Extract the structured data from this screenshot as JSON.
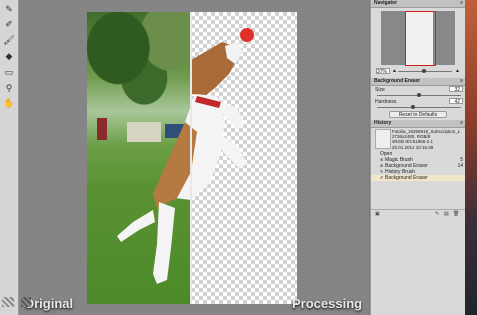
{
  "toolbar": {
    "tools": [
      "magic-brush-icon",
      "background-eraser-icon",
      "brush-icon",
      "bucket-icon",
      "eraser-icon",
      "zoom-icon",
      "hand-icon"
    ]
  },
  "workspace": {
    "left_label": "Original",
    "right_label": "Processing"
  },
  "navigator": {
    "title": "Navigator",
    "zoom": "37%"
  },
  "background_eraser": {
    "title": "Background Eraser",
    "size_label": "Size",
    "size_value": "32",
    "hardness_label": "Hardness",
    "hardness_value": "42",
    "reset_label": "Reset to Defaults"
  },
  "history": {
    "title": "History",
    "file_lines": [
      "Fotolia_15268918_Subscription_L",
      "2736x2480, RGB/8",
      "sRGB IEC61966-2.1",
      "20.01.2012 10:16:39"
    ],
    "items": [
      {
        "label": "Open",
        "count": ""
      },
      {
        "label": "Magic Brush",
        "count": "5"
      },
      {
        "label": "Background Eraser",
        "count": "14"
      },
      {
        "label": "History Brush",
        "count": ""
      },
      {
        "label": "Background Eraser",
        "count": ""
      }
    ]
  },
  "colors": {
    "accent": "#d02020",
    "selected_row": "#f1e7c8",
    "ball": "#e0322a",
    "collar": "#c0282a"
  }
}
